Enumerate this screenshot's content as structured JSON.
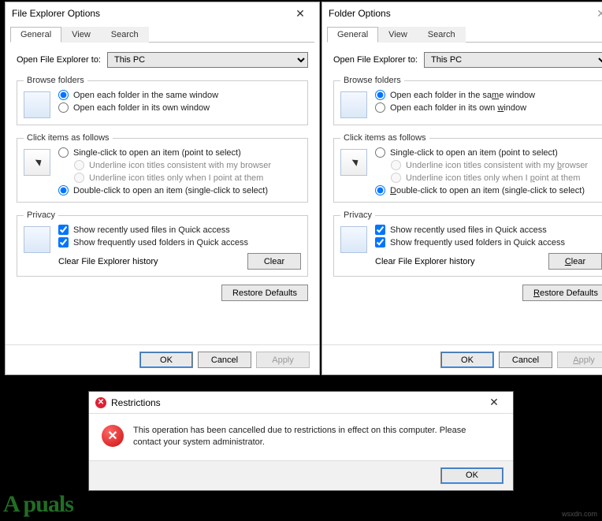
{
  "dialogs": [
    {
      "title": "File Explorer Options",
      "tabs": [
        "General",
        "View",
        "Search"
      ],
      "active_tab": "General",
      "open_label": "Open File Explorer to:",
      "open_value": "This PC",
      "browse": {
        "legend": "Browse folders",
        "opt_same": "Open each folder in the same window",
        "opt_own": "Open each folder in its own window",
        "selected": "same"
      },
      "click": {
        "legend": "Click items as follows",
        "opt_single": "Single-click to open an item (point to select)",
        "sub_browser": "Underline icon titles consistent with my browser",
        "sub_point": "Underline icon titles only when I point at them",
        "opt_double": "Double-click to open an item (single-click to select)",
        "selected": "double"
      },
      "privacy": {
        "legend": "Privacy",
        "files": "Show recently used files in Quick access",
        "folders": "Show frequently used folders in Quick access",
        "clear_label": "Clear File Explorer history",
        "clear_btn": "Clear"
      },
      "restore": "Restore Defaults",
      "ok": "OK",
      "cancel": "Cancel",
      "apply": "Apply",
      "underline_mode": false
    },
    {
      "title": "Folder Options",
      "tabs": [
        "General",
        "View",
        "Search"
      ],
      "active_tab": "General",
      "open_label": "Open File Explorer to:",
      "open_value": "This PC",
      "browse": {
        "legend": "Browse folders",
        "opt_same_pre": "Open each folder in the sa",
        "opt_same_u": "m",
        "opt_same_post": "e window",
        "opt_own_pre": "Open each folder in its own ",
        "opt_own_u": "w",
        "opt_own_post": "indow",
        "selected": "same"
      },
      "click": {
        "legend": "Click items as follows",
        "opt_single": "Single-click to open an item (point to select)",
        "sub_browser_pre": "Underline icon titles consistent with my ",
        "sub_browser_u": "b",
        "sub_browser_post": "rowser",
        "sub_point_pre": "Underline icon titles only when I ",
        "sub_point_u": "p",
        "sub_point_post": "oint at them",
        "opt_double_pre": "",
        "opt_double_u": "D",
        "opt_double_post": "ouble-click to open an item (single-click to select)",
        "selected": "double"
      },
      "privacy": {
        "legend": "Privacy",
        "files": "Show recently used files in Quick access",
        "folders": "Show frequently used folders in Quick access",
        "clear_label": "Clear File Explorer history",
        "clear_btn_u": "C",
        "clear_btn_post": "lear"
      },
      "restore_u": "R",
      "restore_post": "estore Defaults",
      "ok": "OK",
      "cancel": "Cancel",
      "apply_u": "A",
      "apply_post": "pply",
      "underline_mode": true
    }
  ],
  "error": {
    "title": "Restrictions",
    "message": "This operation has been cancelled due to restrictions in effect on this computer. Please contact your system administrator.",
    "ok": "OK"
  },
  "watermark": "A  puals",
  "site": "wsxdn.com"
}
